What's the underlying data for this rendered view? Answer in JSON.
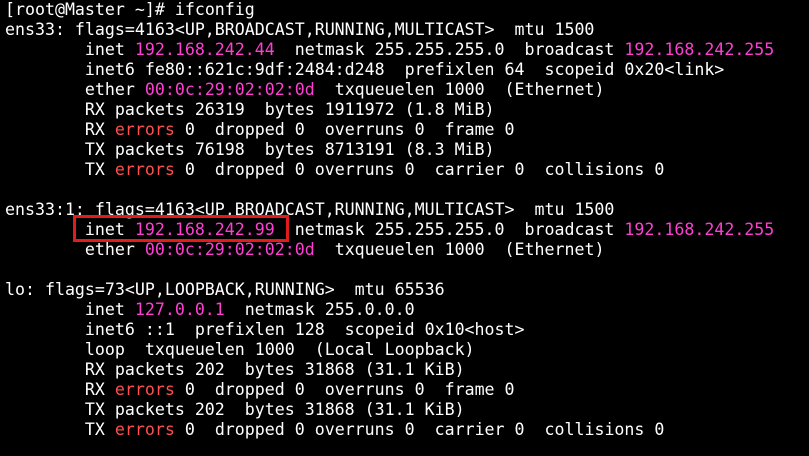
{
  "prompt": {
    "text": "[root@Master ~]# ",
    "command": "ifconfig"
  },
  "blocks": [
    {
      "name": "ens33",
      "lines": [
        [
          {
            "t": "ens33: flags=4163<UP,BROADCAST,RUNNING,MULTICAST>  mtu 1500"
          }
        ],
        [
          {
            "t": "        inet "
          },
          {
            "t": "192.168.242.44",
            "c": "mag"
          },
          {
            "t": "  netmask 255.255.255.0  broadcast "
          },
          {
            "t": "192.168.242.255",
            "c": "mag"
          }
        ],
        [
          {
            "t": "        inet6 fe80::621c:9df:2484:d248  prefixlen 64  scopeid 0x20<link>"
          }
        ],
        [
          {
            "t": "        ether "
          },
          {
            "t": "00:0c:29:02:02:0d",
            "c": "mag"
          },
          {
            "t": "  txqueuelen 1000  (Ethernet)"
          }
        ],
        [
          {
            "t": "        RX packets 26319  bytes 1911972 (1.8 MiB)"
          }
        ],
        [
          {
            "t": "        RX "
          },
          {
            "t": "errors",
            "c": "red"
          },
          {
            "t": " 0  dropped 0  overruns 0  frame 0"
          }
        ],
        [
          {
            "t": "        TX packets 76198  bytes 8713191 (8.3 MiB)"
          }
        ],
        [
          {
            "t": "        TX "
          },
          {
            "t": "errors",
            "c": "red"
          },
          {
            "t": " 0  dropped 0 overruns 0  carrier 0  collisions 0"
          }
        ]
      ]
    },
    {
      "name": "ens33:1",
      "lines": [
        [
          {
            "t": "ens33:1: flags=4163<UP,BROADCAST,RUNNING,MULTICAST>  mtu 1500"
          }
        ],
        [
          {
            "t": "        inet "
          },
          {
            "t": "192.168.242.99",
            "c": "mag"
          },
          {
            "t": "  netmask 255.255.255.0  broadcast "
          },
          {
            "t": "192.168.242.255",
            "c": "mag"
          }
        ],
        [
          {
            "t": "        ether "
          },
          {
            "t": "00:0c:29:02:02:0d",
            "c": "mag"
          },
          {
            "t": "  txqueuelen 1000  (Ethernet)"
          }
        ]
      ]
    },
    {
      "name": "lo",
      "lines": [
        [
          {
            "t": "lo: flags=73<UP,LOOPBACK,RUNNING>  mtu 65536"
          }
        ],
        [
          {
            "t": "        inet "
          },
          {
            "t": "127.0.0.1",
            "c": "mag"
          },
          {
            "t": "  netmask 255.0.0.0"
          }
        ],
        [
          {
            "t": "        inet6 ::1  prefixlen 128  scopeid 0x10<host>"
          }
        ],
        [
          {
            "t": "        loop  txqueuelen 1000  (Local Loopback)"
          }
        ],
        [
          {
            "t": "        RX packets 202  bytes 31868 (31.1 KiB)"
          }
        ],
        [
          {
            "t": "        RX "
          },
          {
            "t": "errors",
            "c": "red"
          },
          {
            "t": " 0  dropped 0  overruns 0  frame 0"
          }
        ],
        [
          {
            "t": "        TX packets 202  bytes 31868 (31.1 KiB)"
          }
        ],
        [
          {
            "t": "        TX "
          },
          {
            "t": "errors",
            "c": "red"
          },
          {
            "t": " 0  dropped 0 overruns 0  carrier 0  collisions 0"
          }
        ]
      ]
    }
  ],
  "colors": {
    "background": "#000000",
    "text": "#ffffff",
    "address": "#ff3ed2",
    "error": "#ff4f4f",
    "highlight_box": "#e21b1b"
  }
}
